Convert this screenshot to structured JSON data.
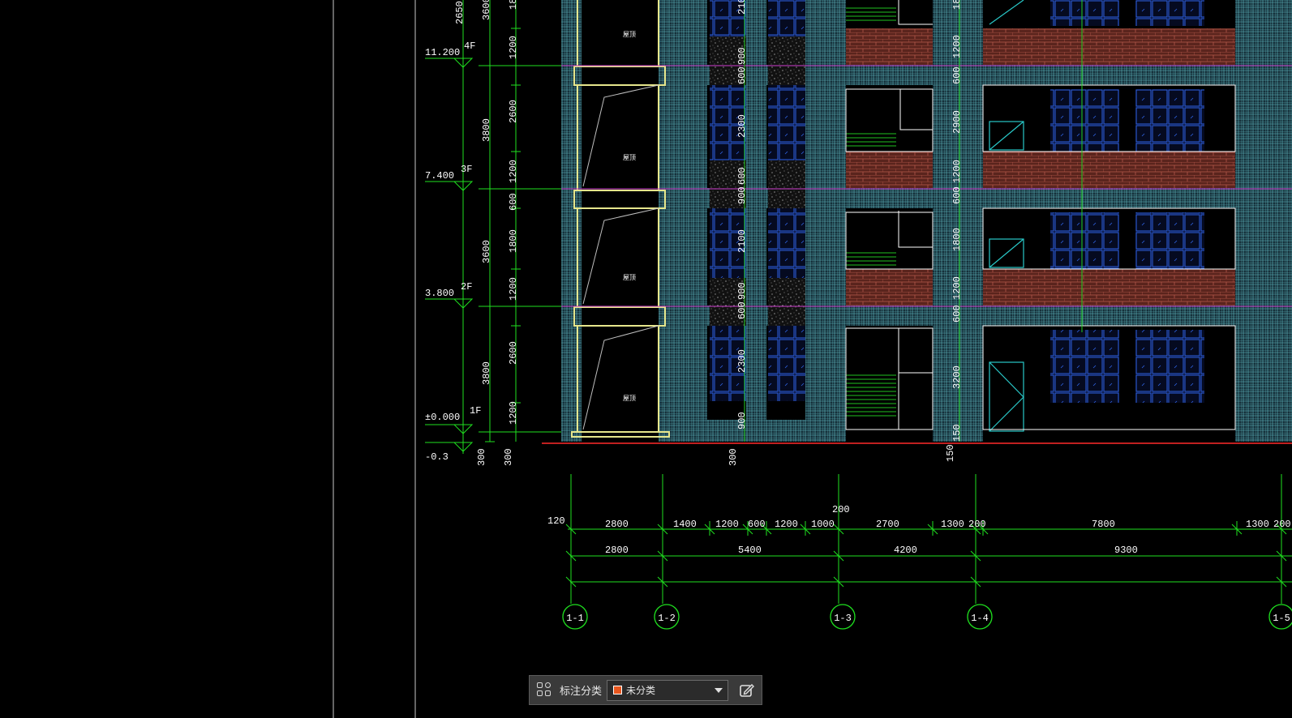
{
  "toolbar": {
    "label": "标注分类",
    "selected_category": "未分类",
    "swatch_color": "#e8561e",
    "grid_icon": "grid-icon",
    "edit_icon": "edit-note-icon"
  },
  "colors": {
    "background": "#000000",
    "dimension": "#00ff00",
    "text": "#ffffff",
    "wall": "#6ec5c5",
    "window": "#1f4fcf",
    "brick": "#8a3a2e",
    "ground": "#c02020",
    "slab": "#e0e080",
    "panel_divider": "#c8c8c8"
  },
  "elevation_marks": [
    {
      "value": "11.200",
      "floor": "4F"
    },
    {
      "value": "7.400",
      "floor": "3F"
    },
    {
      "value": "3.800",
      "floor": "2F"
    },
    {
      "value": "±0.000",
      "floor": "1F"
    },
    {
      "value": "-0.3",
      "floor": ""
    }
  ],
  "vertical_dims_outer": [
    "2650",
    "3800",
    "3600",
    "3800"
  ],
  "vertical_dims_top": [
    "3600",
    "18"
  ],
  "vertical_dims_inner": [
    "1200",
    "2600",
    "1200",
    "600",
    "1800",
    "1200",
    "2600",
    "1200"
  ],
  "bottom_small_dims": [
    "300",
    "300",
    "300",
    "150"
  ],
  "column_dims": {
    "a": [
      "210",
      "900",
      "600",
      "2300",
      "600",
      "900",
      "2100",
      "900",
      "600",
      "2300",
      "900"
    ],
    "b": [
      "18",
      "1200",
      "600",
      "2900",
      "1200",
      "600",
      "1800",
      "1200",
      "600",
      "3200",
      "150"
    ]
  },
  "window_labels": [
    "屋顶",
    "屋顶",
    "屋顶",
    "屋顶"
  ],
  "dim_row1": {
    "left_label": "120",
    "top_label": "200",
    "values": [
      "2800",
      "1400",
      "1200",
      "600",
      "1200",
      "1000",
      "2700",
      "1300",
      "200",
      "7800",
      "1300",
      "200"
    ]
  },
  "dim_row2": [
    "2800",
    "5400",
    "4200",
    "9300"
  ],
  "axes": [
    "1-1",
    "1-2",
    "1-3",
    "1-4",
    "1-5"
  ]
}
